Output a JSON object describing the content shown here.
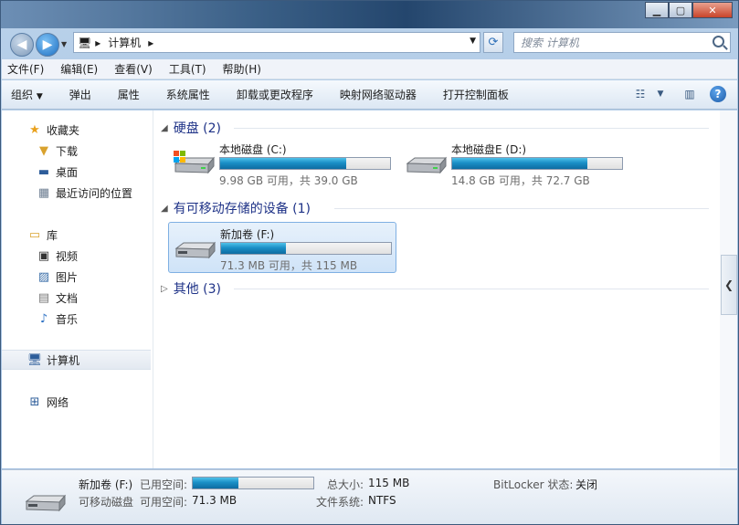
{
  "breadcrumb": {
    "location": "计算机"
  },
  "search": {
    "placeholder": "搜索 计算机"
  },
  "menu": [
    "文件(F)",
    "编辑(E)",
    "查看(V)",
    "工具(T)",
    "帮助(H)"
  ],
  "toolbar": {
    "organize": "组织",
    "items": [
      "弹出",
      "属性",
      "系统属性",
      "卸载或更改程序",
      "映射网络驱动器",
      "打开控制面板"
    ]
  },
  "nav": {
    "favorites": "收藏夹",
    "favorites_items": [
      "下载",
      "桌面",
      "最近访问的位置"
    ],
    "libraries": "库",
    "libraries_items": [
      "视频",
      "图片",
      "文档",
      "音乐"
    ],
    "computer": "计算机",
    "network": "网络"
  },
  "groups": {
    "hdd": "硬盘 (2)",
    "removable": "有可移动存储的设备 (1)",
    "other": "其他 (3)"
  },
  "drives": [
    {
      "name": "本地磁盘 (C:)",
      "info": "9.98 GB 可用，共 39.0 GB",
      "used_fraction": 0.744
    },
    {
      "name": "本地磁盘E (D:)",
      "info": "14.8 GB 可用，共 72.7 GB",
      "used_fraction": 0.796
    },
    {
      "name": "新加卷 (F:)",
      "info": "71.3 MB 可用，共 115 MB",
      "used_fraction": 0.38
    }
  ],
  "status": {
    "name": "新加卷 (F:)",
    "type": "可移动磁盘",
    "used_label": "已用空间:",
    "free_label": "可用空间:",
    "free_value": "71.3 MB",
    "total_label": "总大小:",
    "total_value": "115 MB",
    "fs_label": "文件系统:",
    "fs_value": "NTFS",
    "bitlocker_label": "BitLocker 状态:",
    "bitlocker_value": "关闭",
    "used_fraction": 0.38
  }
}
